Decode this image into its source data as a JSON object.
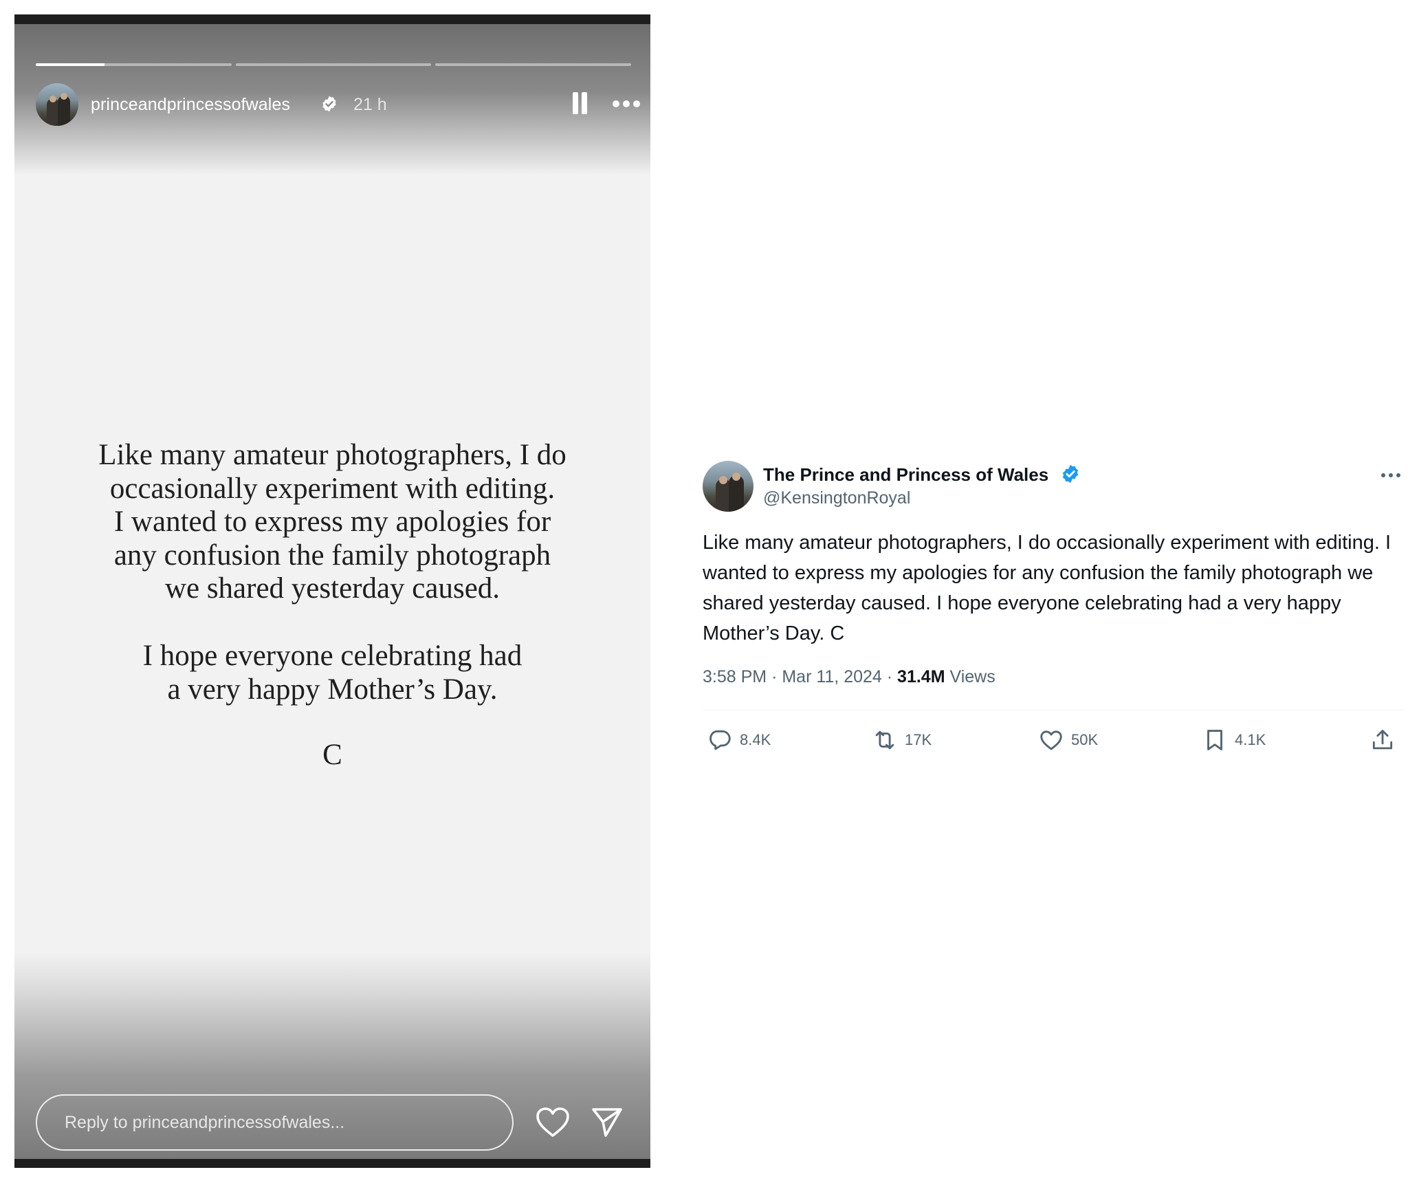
{
  "story": {
    "progress_segments": [
      0.35,
      0,
      0
    ],
    "username": "princeandprincessofwales",
    "time_ago": "21 h",
    "text_paragraph1_lines": [
      "Like many amateur photographers, I do",
      "occasionally experiment with editing.",
      "I wanted to express my apologies for",
      "any confusion the family photograph",
      "we shared yesterday caused."
    ],
    "text_paragraph2_lines": [
      "I hope everyone celebrating had",
      "a very happy Mother’s Day."
    ],
    "signature": "C",
    "reply_placeholder": "Reply to princeandprincessofwales...",
    "icons": {
      "verified": "verified-badge-icon",
      "pause": "pause-icon",
      "more": "more-horizontal-icon",
      "like": "heart-icon",
      "send": "send-icon"
    }
  },
  "tweet": {
    "display_name": "The Prince and Princess of Wales",
    "handle": "@KensingtonRoyal",
    "body": "Like many amateur photographers, I do occasionally experiment with editing. I wanted to express my apologies for any confusion the family photograph we shared yesterday caused. I hope everyone celebrating had a very happy Mother’s Day. C",
    "time": "3:58 PM",
    "date": "Mar 11, 2024",
    "separator": "·",
    "views_count": "31.4M",
    "views_label": "Views",
    "actions": {
      "replies": "8.4K",
      "reposts": "17K",
      "likes": "50K",
      "bookmarks": "4.1K"
    },
    "colors": {
      "verified_blue": "#1d9bf0",
      "text_primary": "#0f1419",
      "text_secondary": "#536471"
    },
    "icons": {
      "verified": "verified-badge-icon",
      "more": "more-horizontal-icon",
      "reply": "reply-icon",
      "repost": "repost-icon",
      "like": "heart-icon",
      "bookmark": "bookmark-icon",
      "share": "share-icon"
    }
  }
}
